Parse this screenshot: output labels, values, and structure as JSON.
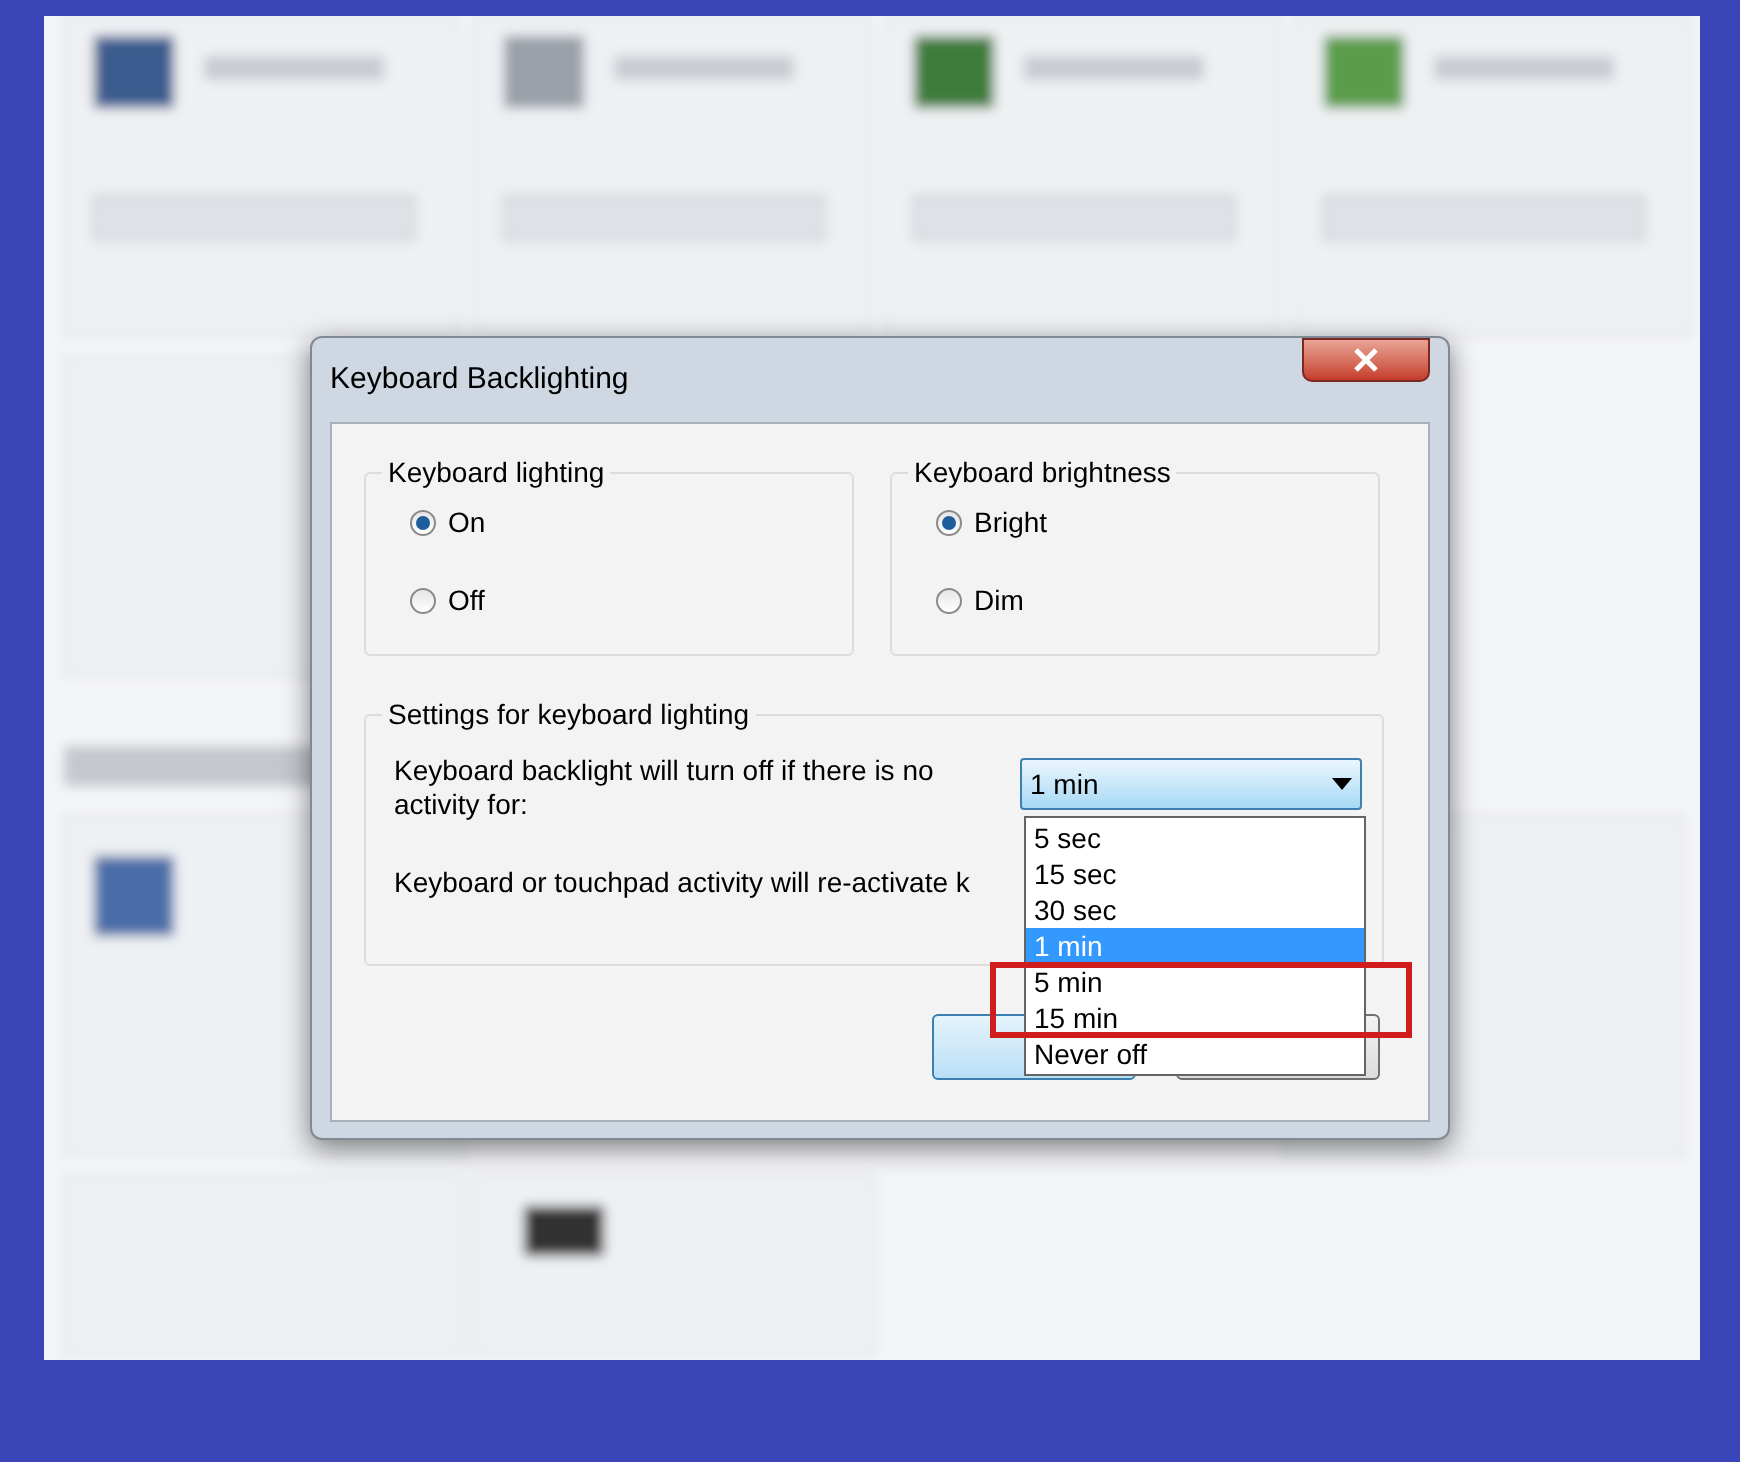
{
  "dialog": {
    "title": "Keyboard Backlighting",
    "groups": [
      {
        "title": "Keyboard lighting",
        "options": [
          {
            "label": "On",
            "selected": true
          },
          {
            "label": "Off",
            "selected": false
          }
        ]
      },
      {
        "title": "Keyboard brightness",
        "options": [
          {
            "label": "Bright",
            "selected": true
          },
          {
            "label": "Dim",
            "selected": false
          }
        ]
      }
    ],
    "settings": {
      "title": "Settings for keyboard lighting",
      "timeout_label": "Keyboard backlight will turn off if there is no activity for:",
      "timeout_value": "1 min",
      "reactivate_text": "Keyboard or touchpad activity will re-activate k",
      "dropdown": {
        "expanded": true,
        "options": [
          {
            "label": "5 sec",
            "selected": false
          },
          {
            "label": "15 sec",
            "selected": false
          },
          {
            "label": "30 sec",
            "selected": false
          },
          {
            "label": "1 min",
            "selected": true
          },
          {
            "label": "5 min",
            "selected": false
          },
          {
            "label": "15 min",
            "selected": false
          },
          {
            "label": "Never off",
            "selected": false
          }
        ]
      }
    },
    "buttons": [
      {
        "default": true
      },
      {
        "default": false
      }
    ]
  },
  "annotations": [
    {
      "kind": "highlight-box"
    }
  ]
}
